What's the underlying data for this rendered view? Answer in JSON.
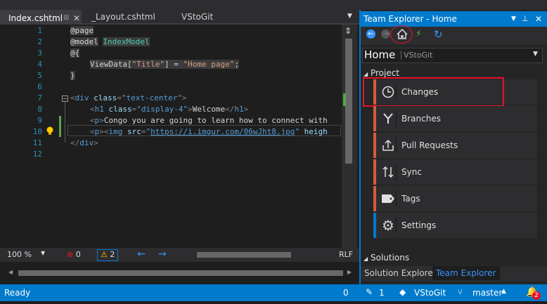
{
  "editor": {
    "tabs": [
      {
        "label": "Index.cshtml",
        "active": true
      },
      {
        "label": "_Layout.cshtml",
        "active": false
      },
      {
        "label": "VStoGit",
        "active": false
      }
    ],
    "line_numbers": [
      "1",
      "2",
      "3",
      "4",
      "5",
      "6",
      "7",
      "8",
      "9",
      "10",
      "11",
      "12"
    ],
    "code": {
      "l1": "@page",
      "l2_kw": "@model",
      "l2_type": "IndexModel",
      "l3": "@{",
      "l4_a": "ViewData[",
      "l4_b": "\"Title\"",
      "l4_c": "] = ",
      "l4_d": "\"Home page\"",
      "l4_e": ";",
      "l5": "}",
      "l7_a": "<",
      "l7_tag": "div",
      "l7_attr": " class",
      "l7_eq": "=",
      "l7_val": "\"text-center\"",
      "l7_close": ">",
      "l8_a": "<",
      "l8_tag": "h1",
      "l8_attr": " class",
      "l8_eq": "=",
      "l8_val": "\"display-4\"",
      "l8_b": ">",
      "l8_text": "Welcome",
      "l8_c": "</",
      "l8_tag2": "h1",
      "l8_d": ">",
      "l9_a": "<",
      "l9_tag": "p",
      "l9_b": ">",
      "l9_text": "Congo you are going to learn how to connect with",
      "l10_a": "<",
      "l10_tag": "p",
      "l10_b": "><",
      "l10_tag2": "img",
      "l10_attr": " src",
      "l10_eq": "=",
      "l10_q": "\"",
      "l10_link": "https://i.imgur.com/06wJht8.jpg",
      "l10_q2": "\"",
      "l10_attr2": " heigh",
      "l11_a": "</",
      "l11_tag": "div",
      "l11_b": ">"
    },
    "status": {
      "zoom": "100 %",
      "errors": "0",
      "warnings": "2",
      "line_ending": "RLF"
    }
  },
  "team_explorer": {
    "title": "Team Explorer - Home",
    "home_label": "Home",
    "home_sub": "VStoGit",
    "section_project": "Project",
    "items": [
      {
        "label": "Changes",
        "icon": "clock-icon"
      },
      {
        "label": "Branches",
        "icon": "branch-icon"
      },
      {
        "label": "Pull Requests",
        "icon": "pull-request-icon"
      },
      {
        "label": "Sync",
        "icon": "sync-icon"
      },
      {
        "label": "Tags",
        "icon": "tag-icon"
      },
      {
        "label": "Settings",
        "icon": "gear-icon"
      }
    ],
    "section_solutions": "Solutions",
    "bottom_tabs": [
      {
        "label": "Solution Explorer",
        "active": false
      },
      {
        "label": "Team Explorer",
        "active": true
      }
    ]
  },
  "statusbar": {
    "state": "Ready",
    "up_count": "0",
    "pending": "1",
    "repo": "VStoGit",
    "branch": "master",
    "notifications": "2"
  },
  "colors": {
    "accent": "#007acc",
    "highlight_box": "#e81123",
    "nav_bar_orange": "#d05e3a",
    "nav_bar_blue": "#007acc"
  }
}
